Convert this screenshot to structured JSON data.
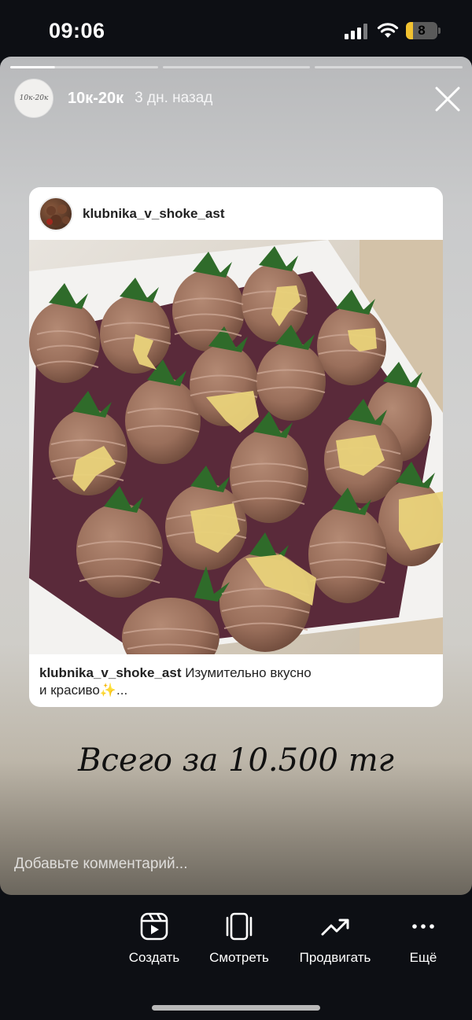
{
  "status_bar": {
    "time": "09:06",
    "battery": "8"
  },
  "story": {
    "username": "10к-20к",
    "time_ago": "3 дн. назад",
    "avatar_text": "10к-20к",
    "progress_segments": 3
  },
  "post": {
    "username": "klubnika_v_shoke_ast",
    "caption_user": "klubnika_v_shoke_ast",
    "caption_text": "Изумительно вкусно",
    "caption_text2": "и красиво✨..."
  },
  "price_text": "Всего за 10.500 тг",
  "comment_placeholder": "Добавьте комментарий...",
  "actions": [
    {
      "label": "Создать",
      "icon": "create-reel-icon"
    },
    {
      "label": "Смотреть",
      "icon": "view-icon"
    },
    {
      "label": "Продвигать",
      "icon": "promote-trend-icon"
    },
    {
      "label": "Ещё",
      "icon": "more-icon"
    }
  ]
}
